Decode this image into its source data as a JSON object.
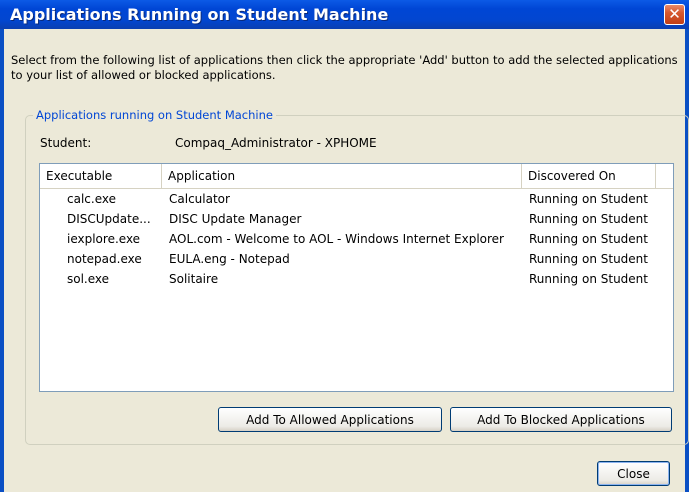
{
  "window": {
    "title": "Applications Running on Student Machine",
    "close_glyph": "✕"
  },
  "instructions": "Select from the following list of applications then click the appropriate 'Add' button to add the selected applications to your list of allowed or blocked applications.",
  "group": {
    "legend": "Applications running on Student Machine",
    "student_label": "Student:",
    "student_value": "Compaq_Administrator - XPHOME"
  },
  "table": {
    "columns": [
      "Executable",
      "Application",
      "Discovered On"
    ],
    "rows": [
      [
        "calc.exe",
        "Calculator",
        "Running on Student"
      ],
      [
        "DISCUpdate...",
        "DISC Update Manager",
        "Running on Student"
      ],
      [
        "iexplore.exe",
        "AOL.com - Welcome to AOL - Windows Internet Explorer",
        "Running on Student"
      ],
      [
        "notepad.exe",
        "EULA.eng - Notepad",
        "Running on Student"
      ],
      [
        "sol.exe",
        "Solitaire",
        "Running on Student"
      ]
    ]
  },
  "buttons": {
    "add_allowed": "Add To Allowed Applications",
    "add_blocked": "Add To Blocked Applications",
    "close": "Close"
  },
  "colors": {
    "titlebar": "#0046d5",
    "dialog_bg": "#ece9d8",
    "legend_text": "#0046d5"
  }
}
